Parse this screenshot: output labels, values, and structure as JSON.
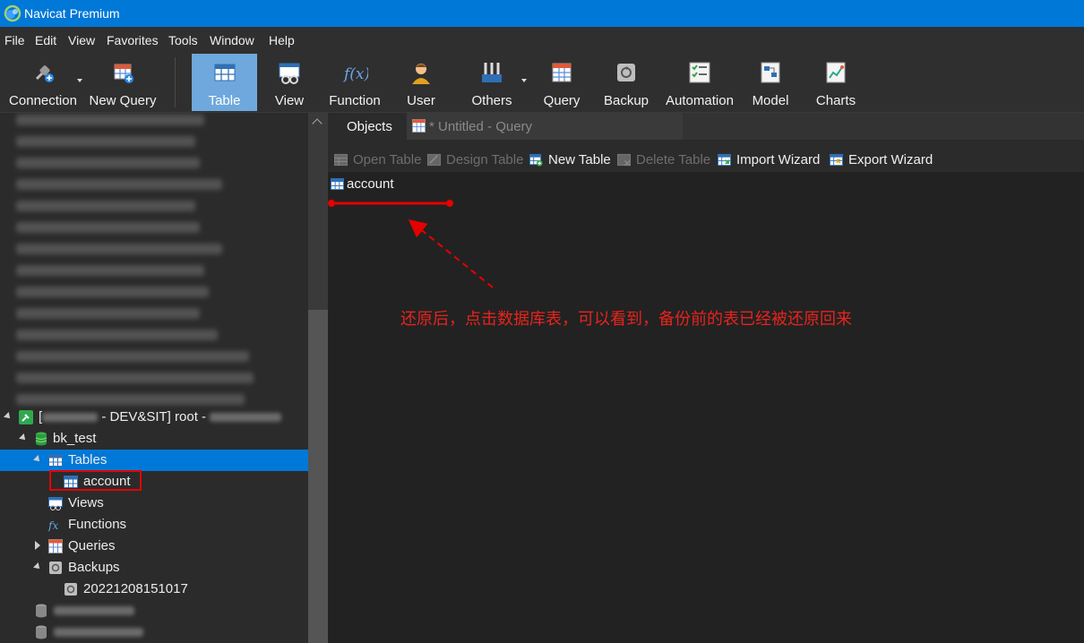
{
  "window": {
    "title": "Navicat Premium"
  },
  "menu": [
    "File",
    "Edit",
    "View",
    "Favorites",
    "Tools",
    "Window",
    "Help"
  ],
  "toolbar": {
    "connection": "Connection",
    "new_query": "New Query",
    "table": "Table",
    "view": "View",
    "function": "Function",
    "user": "User",
    "others": "Others",
    "query": "Query",
    "backup": "Backup",
    "automation": "Automation",
    "model": "Model",
    "charts": "Charts"
  },
  "sidebar": {
    "connection_label_prefix": "[",
    "connection_label_suffix": " - DEV&SIT] root - ",
    "database": "bk_test",
    "tables": "Tables",
    "table_item": "account",
    "views": "Views",
    "functions": "Functions",
    "queries": "Queries",
    "backups": "Backups",
    "backup_item": "20221208151017"
  },
  "tabs": {
    "objects": "Objects",
    "query": "* Untitled - Query"
  },
  "object_toolbar": {
    "open_table": "Open Table",
    "design_table": "Design Table",
    "new_table": "New Table",
    "delete_table": "Delete Table",
    "import_wizard": "Import Wizard",
    "export_wizard": "Export Wizard"
  },
  "objects": {
    "items": [
      "account"
    ]
  },
  "annotation": {
    "text": "还原后，点击数据库表，可以看到，备份前的表已经被还原回来",
    "color": "#e8231c"
  },
  "colors": {
    "accent": "#0078d7",
    "toolbar_active": "#6fa8dc",
    "annotation_red": "#e60000"
  }
}
